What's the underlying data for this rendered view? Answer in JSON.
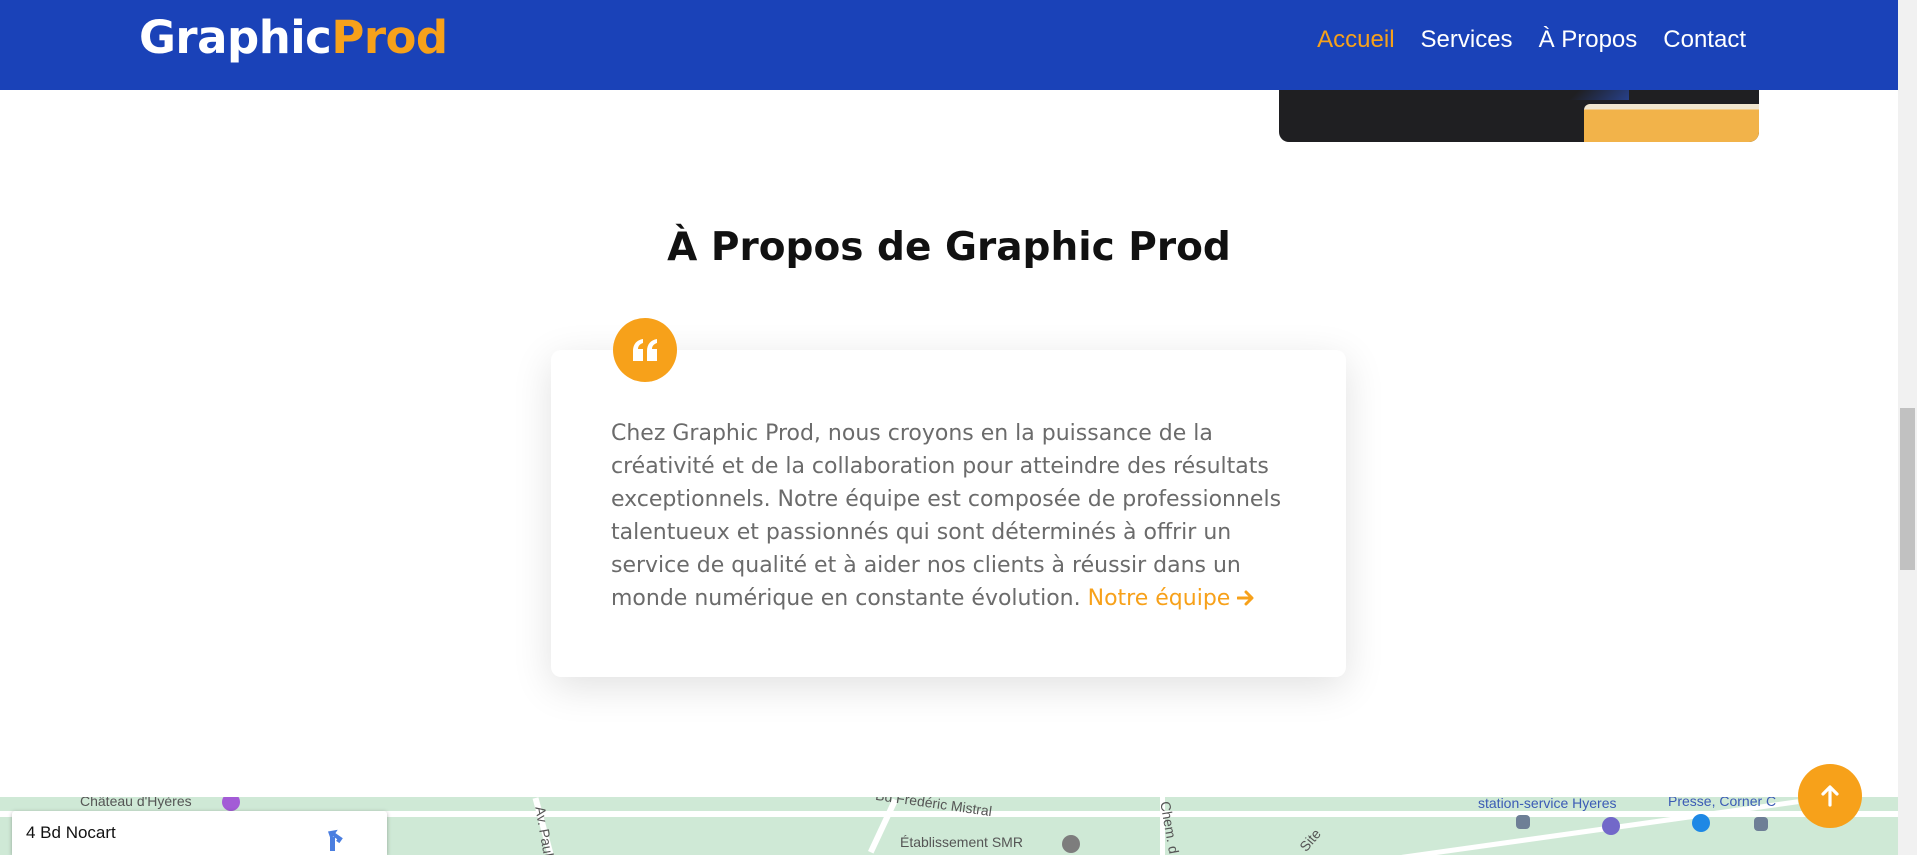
{
  "brand": {
    "part1": "Graphic",
    "part2": "Prod"
  },
  "nav": {
    "items": [
      {
        "label": "Accueil",
        "active": true
      },
      {
        "label": "Services",
        "active": false
      },
      {
        "label": "À Propos",
        "active": false
      },
      {
        "label": "Contact",
        "active": false
      }
    ]
  },
  "about": {
    "title": "À Propos de Graphic Prod",
    "quote_icon": "quote-left-icon",
    "text": "Chez Graphic Prod, nous croyons en la puissance de la créativité et de la collaboration pour atteindre des résultats exceptionnels. Notre équipe est composée de professionnels talentueux et passionnés qui sont déterminés à offrir un service de qualité et à aider nos clients à réussir dans un monde numérique en constante évolution.",
    "link_label": "Notre équipe",
    "link_icon": "arrow-right-icon"
  },
  "map": {
    "address": "4 Bd Nocart",
    "labels": [
      "Château d'Hyères",
      "Av. Paul",
      "Bd Frédéric Mistral",
      "Établissement SMR",
      "Chem. d",
      "Site",
      "station-service Hyeres",
      "Presse, Corner C"
    ]
  },
  "scroll_top_icon": "arrow-up-icon",
  "colors": {
    "primary": "#1a42b8",
    "accent": "#f7a11a",
    "text": "#6b6b6b"
  }
}
